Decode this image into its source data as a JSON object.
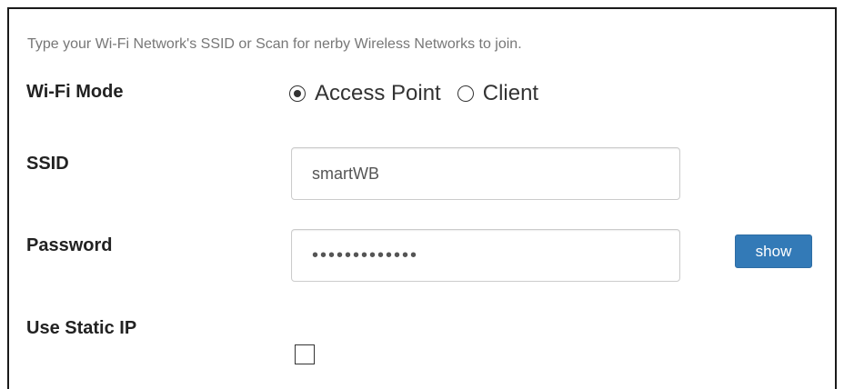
{
  "form": {
    "hint": "Type your Wi-Fi Network's SSID or Scan for nerby Wireless Networks to join.",
    "wifi_mode": {
      "label": "Wi-Fi Mode",
      "options": [
        {
          "label": "Access Point",
          "selected": true
        },
        {
          "label": "Client",
          "selected": false
        }
      ]
    },
    "ssid": {
      "label": "SSID",
      "value": "smartWB"
    },
    "password": {
      "label": "Password",
      "masked_value": "•••••••••••••",
      "show_button": "show"
    },
    "static_ip": {
      "label": "Use Static IP",
      "checked": false
    }
  },
  "colors": {
    "button_bg": "#337ab7",
    "button_text": "#ffffff",
    "hint_text": "#777777"
  }
}
